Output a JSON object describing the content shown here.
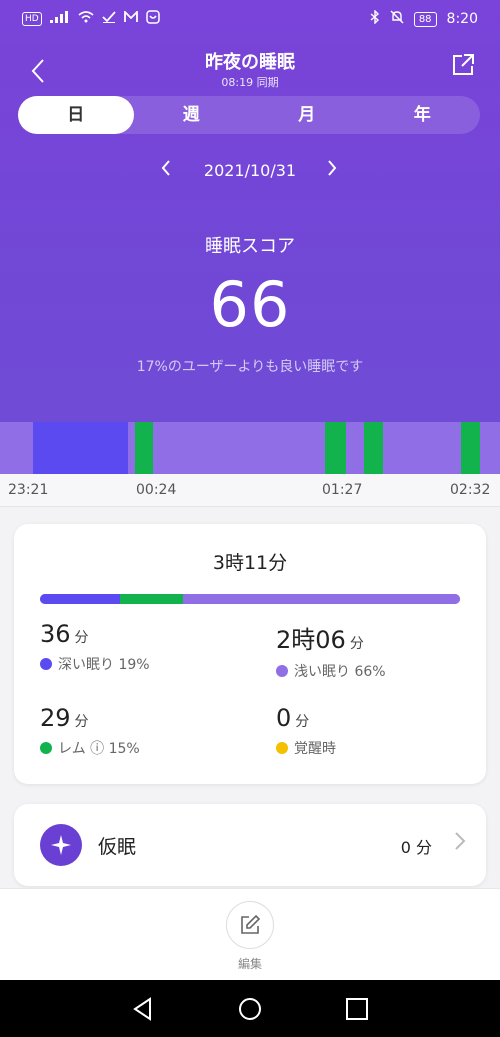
{
  "status_bar": {
    "left_badge": "HD",
    "battery": "88",
    "time": "8:20"
  },
  "header": {
    "title": "昨夜の睡眠",
    "subtitle": "08:19 同期"
  },
  "tabs": [
    {
      "label": "日",
      "active": true
    },
    {
      "label": "週",
      "active": false
    },
    {
      "label": "月",
      "active": false
    },
    {
      "label": "年",
      "active": false
    }
  ],
  "date": "2021/10/31",
  "score": {
    "label": "睡眠スコア",
    "value": "66",
    "note": "17%のユーザーよりも良い睡眠です"
  },
  "timeline": {
    "ticks": [
      "23:21",
      "00:24",
      "01:27",
      "02:32"
    ]
  },
  "summary": {
    "total": "3時11分",
    "stats": [
      {
        "value_html": "36",
        "unit": "分",
        "label": "深い眠り 19%",
        "color": "#5b4af0"
      },
      {
        "value_html": "2時06",
        "unit": "分",
        "label": "浅い眠り 66%",
        "color": "#8f6ee6"
      },
      {
        "value_html": "29",
        "unit": "分",
        "label": "レム ⓘ 15%",
        "color": "#12b24d"
      },
      {
        "value_html": "0",
        "unit": "分",
        "label": "覚醒時",
        "color": "#f5c000"
      }
    ]
  },
  "nap": {
    "label": "仮眠",
    "value": "0 分"
  },
  "bottom": {
    "edit_label": "編集"
  },
  "colors": {
    "deep": "#5b4af0",
    "light": "#8f6ee6",
    "rem": "#12b24d",
    "awake": "#f5c000",
    "hero": "#7148d6"
  }
}
